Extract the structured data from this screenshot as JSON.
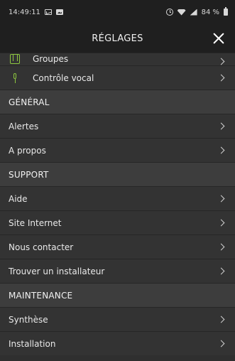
{
  "status_bar": {
    "time": "14:49:11",
    "battery": "84 %"
  },
  "header": {
    "title": "RÉGLAGES"
  },
  "colors": {
    "accent_green": "#8dc63f",
    "header_bg": "#1f1f1f",
    "row_bg": "#333333",
    "section_bg": "#3d3d3d"
  },
  "top_items": [
    {
      "label": "Groupes",
      "icon": "groups-icon"
    },
    {
      "label": "Contrôle vocal",
      "icon": "microphone-icon"
    }
  ],
  "sections": [
    {
      "title": "GÉNÉRAL",
      "items": [
        "Alertes",
        "A propos"
      ]
    },
    {
      "title": "SUPPORT",
      "items": [
        "Aide",
        "Site Internet",
        "Nous contacter",
        "Trouver un installateur"
      ]
    },
    {
      "title": "MAINTENANCE",
      "items": [
        "Synthèse",
        "Installation"
      ]
    }
  ]
}
